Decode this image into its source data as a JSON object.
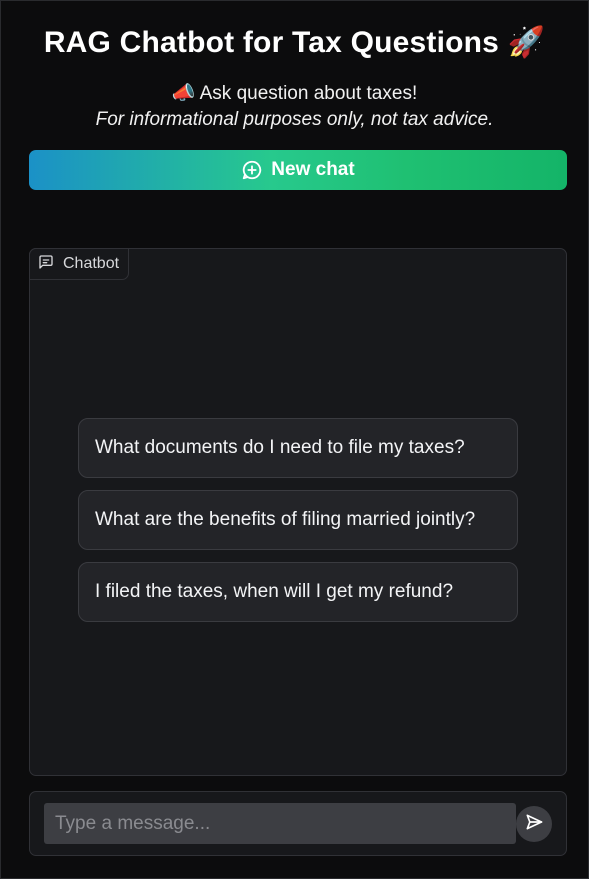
{
  "header": {
    "title": "RAG Chatbot for Tax Questions 🚀",
    "subtitle": "📣 Ask question about taxes!",
    "disclaimer": "For informational purposes only, not tax advice."
  },
  "new_chat": {
    "label": "New chat",
    "icon": "plus-circle-icon",
    "gradient": [
      "#1b91c7",
      "#27c98d",
      "#14b468"
    ]
  },
  "chatbot": {
    "label": "Chatbot",
    "icon": "chat-bubble-icon",
    "examples": [
      "What documents do I need to file my taxes?",
      "What are the benefits of filing married jointly?",
      "I filed the taxes, when will I get my refund?"
    ]
  },
  "composer": {
    "placeholder": "Type a message...",
    "value": "",
    "send_icon": "send-icon"
  }
}
